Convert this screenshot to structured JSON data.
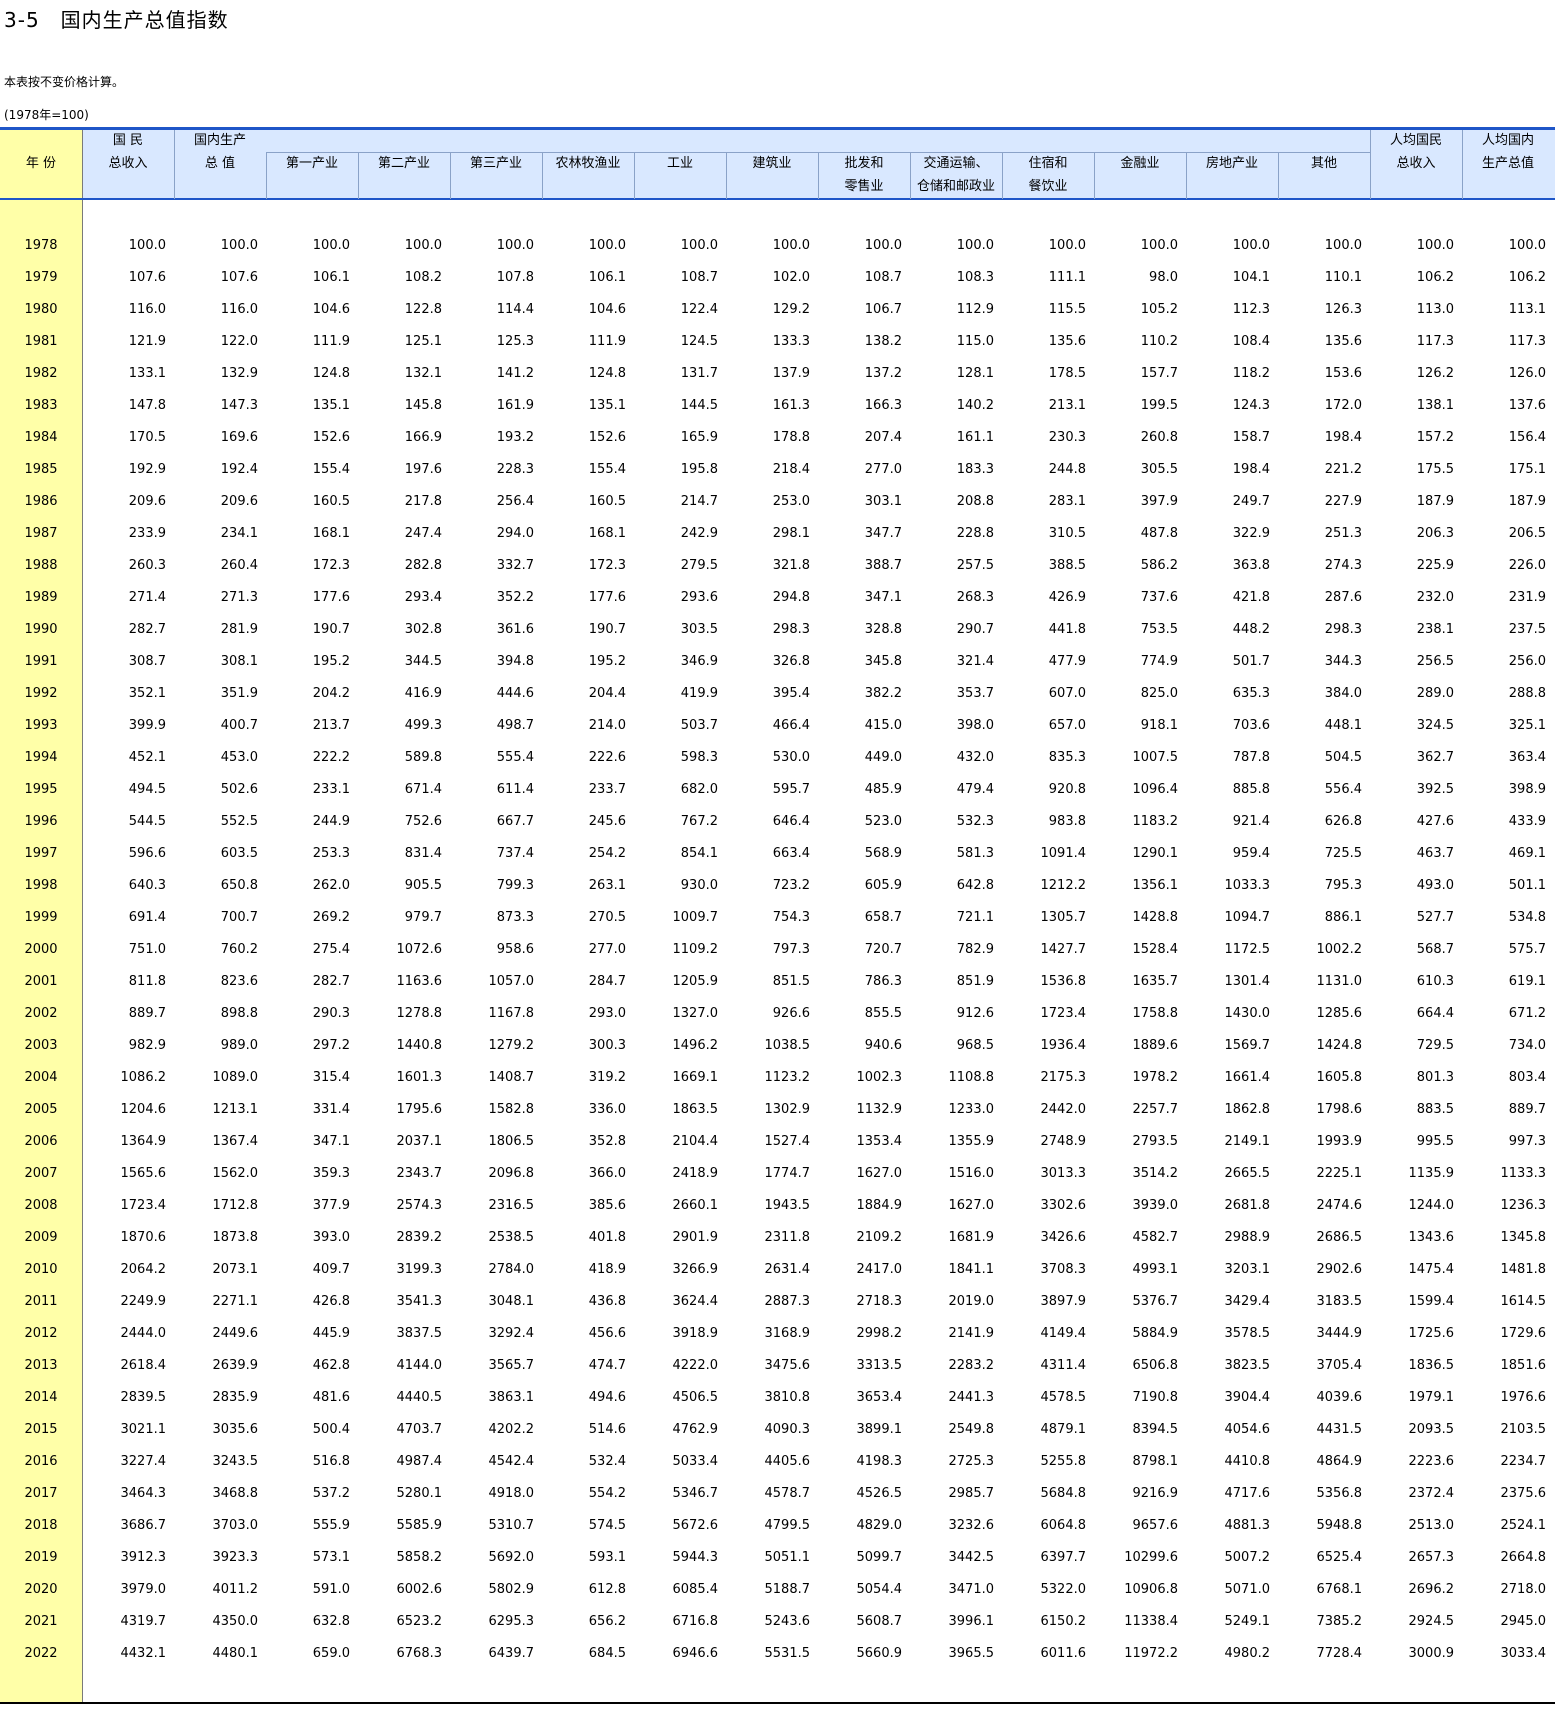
{
  "title": "3-5　国内生产总值指数",
  "note": "本表按不变价格计算。",
  "base": "(1978年=100)",
  "header": {
    "year": "年  份",
    "gni": [
      "国  民",
      "总收入"
    ],
    "gdp": [
      "国内生产",
      "总  值"
    ],
    "primary": "第一产业",
    "secondary": "第二产业",
    "tertiary": "第三产业",
    "agri": "农林牧渔业",
    "industry": "工业",
    "construction": "建筑业",
    "wholesale": [
      "批发和",
      "零售业"
    ],
    "transport": [
      "交通运输、",
      "仓储和邮政业"
    ],
    "hotel": [
      "住宿和",
      "餐饮业"
    ],
    "finance": "金融业",
    "realestate": "房地产业",
    "other": "其他",
    "gni_pc": [
      "人均国民",
      "总收入"
    ],
    "gdp_pc": [
      "人均国内",
      "生产总值"
    ]
  },
  "colors": {
    "header_bg": "#d9e8ff",
    "year_bg": "#ffffa8",
    "rule": "#1f56c8"
  },
  "rows": [
    [
      "1978",
      "100.0",
      "100.0",
      "100.0",
      "100.0",
      "100.0",
      "100.0",
      "100.0",
      "100.0",
      "100.0",
      "100.0",
      "100.0",
      "100.0",
      "100.0",
      "100.0",
      "100.0",
      "100.0"
    ],
    [
      "1979",
      "107.6",
      "107.6",
      "106.1",
      "108.2",
      "107.8",
      "106.1",
      "108.7",
      "102.0",
      "108.7",
      "108.3",
      "111.1",
      "98.0",
      "104.1",
      "110.1",
      "106.2",
      "106.2"
    ],
    [
      "1980",
      "116.0",
      "116.0",
      "104.6",
      "122.8",
      "114.4",
      "104.6",
      "122.4",
      "129.2",
      "106.7",
      "112.9",
      "115.5",
      "105.2",
      "112.3",
      "126.3",
      "113.0",
      "113.1"
    ],
    [
      "1981",
      "121.9",
      "122.0",
      "111.9",
      "125.1",
      "125.3",
      "111.9",
      "124.5",
      "133.3",
      "138.2",
      "115.0",
      "135.6",
      "110.2",
      "108.4",
      "135.6",
      "117.3",
      "117.3"
    ],
    [
      "1982",
      "133.1",
      "132.9",
      "124.8",
      "132.1",
      "141.2",
      "124.8",
      "131.7",
      "137.9",
      "137.2",
      "128.1",
      "178.5",
      "157.7",
      "118.2",
      "153.6",
      "126.2",
      "126.0"
    ],
    [
      "1983",
      "147.8",
      "147.3",
      "135.1",
      "145.8",
      "161.9",
      "135.1",
      "144.5",
      "161.3",
      "166.3",
      "140.2",
      "213.1",
      "199.5",
      "124.3",
      "172.0",
      "138.1",
      "137.6"
    ],
    [
      "1984",
      "170.5",
      "169.6",
      "152.6",
      "166.9",
      "193.2",
      "152.6",
      "165.9",
      "178.8",
      "207.4",
      "161.1",
      "230.3",
      "260.8",
      "158.7",
      "198.4",
      "157.2",
      "156.4"
    ],
    [
      "1985",
      "192.9",
      "192.4",
      "155.4",
      "197.6",
      "228.3",
      "155.4",
      "195.8",
      "218.4",
      "277.0",
      "183.3",
      "244.8",
      "305.5",
      "198.4",
      "221.2",
      "175.5",
      "175.1"
    ],
    [
      "1986",
      "209.6",
      "209.6",
      "160.5",
      "217.8",
      "256.4",
      "160.5",
      "214.7",
      "253.0",
      "303.1",
      "208.8",
      "283.1",
      "397.9",
      "249.7",
      "227.9",
      "187.9",
      "187.9"
    ],
    [
      "1987",
      "233.9",
      "234.1",
      "168.1",
      "247.4",
      "294.0",
      "168.1",
      "242.9",
      "298.1",
      "347.7",
      "228.8",
      "310.5",
      "487.8",
      "322.9",
      "251.3",
      "206.3",
      "206.5"
    ],
    [
      "1988",
      "260.3",
      "260.4",
      "172.3",
      "282.8",
      "332.7",
      "172.3",
      "279.5",
      "321.8",
      "388.7",
      "257.5",
      "388.5",
      "586.2",
      "363.8",
      "274.3",
      "225.9",
      "226.0"
    ],
    [
      "1989",
      "271.4",
      "271.3",
      "177.6",
      "293.4",
      "352.2",
      "177.6",
      "293.6",
      "294.8",
      "347.1",
      "268.3",
      "426.9",
      "737.6",
      "421.8",
      "287.6",
      "232.0",
      "231.9"
    ],
    [
      "1990",
      "282.7",
      "281.9",
      "190.7",
      "302.8",
      "361.6",
      "190.7",
      "303.5",
      "298.3",
      "328.8",
      "290.7",
      "441.8",
      "753.5",
      "448.2",
      "298.3",
      "238.1",
      "237.5"
    ],
    [
      "1991",
      "308.7",
      "308.1",
      "195.2",
      "344.5",
      "394.8",
      "195.2",
      "346.9",
      "326.8",
      "345.8",
      "321.4",
      "477.9",
      "774.9",
      "501.7",
      "344.3",
      "256.5",
      "256.0"
    ],
    [
      "1992",
      "352.1",
      "351.9",
      "204.2",
      "416.9",
      "444.6",
      "204.4",
      "419.9",
      "395.4",
      "382.2",
      "353.7",
      "607.0",
      "825.0",
      "635.3",
      "384.0",
      "289.0",
      "288.8"
    ],
    [
      "1993",
      "399.9",
      "400.7",
      "213.7",
      "499.3",
      "498.7",
      "214.0",
      "503.7",
      "466.4",
      "415.0",
      "398.0",
      "657.0",
      "918.1",
      "703.6",
      "448.1",
      "324.5",
      "325.1"
    ],
    [
      "1994",
      "452.1",
      "453.0",
      "222.2",
      "589.8",
      "555.4",
      "222.6",
      "598.3",
      "530.0",
      "449.0",
      "432.0",
      "835.3",
      "1007.5",
      "787.8",
      "504.5",
      "362.7",
      "363.4"
    ],
    [
      "1995",
      "494.5",
      "502.6",
      "233.1",
      "671.4",
      "611.4",
      "233.7",
      "682.0",
      "595.7",
      "485.9",
      "479.4",
      "920.8",
      "1096.4",
      "885.8",
      "556.4",
      "392.5",
      "398.9"
    ],
    [
      "1996",
      "544.5",
      "552.5",
      "244.9",
      "752.6",
      "667.7",
      "245.6",
      "767.2",
      "646.4",
      "523.0",
      "532.3",
      "983.8",
      "1183.2",
      "921.4",
      "626.8",
      "427.6",
      "433.9"
    ],
    [
      "1997",
      "596.6",
      "603.5",
      "253.3",
      "831.4",
      "737.4",
      "254.2",
      "854.1",
      "663.4",
      "568.9",
      "581.3",
      "1091.4",
      "1290.1",
      "959.4",
      "725.5",
      "463.7",
      "469.1"
    ],
    [
      "1998",
      "640.3",
      "650.8",
      "262.0",
      "905.5",
      "799.3",
      "263.1",
      "930.0",
      "723.2",
      "605.9",
      "642.8",
      "1212.2",
      "1356.1",
      "1033.3",
      "795.3",
      "493.0",
      "501.1"
    ],
    [
      "1999",
      "691.4",
      "700.7",
      "269.2",
      "979.7",
      "873.3",
      "270.5",
      "1009.7",
      "754.3",
      "658.7",
      "721.1",
      "1305.7",
      "1428.8",
      "1094.7",
      "886.1",
      "527.7",
      "534.8"
    ],
    [
      "2000",
      "751.0",
      "760.2",
      "275.4",
      "1072.6",
      "958.6",
      "277.0",
      "1109.2",
      "797.3",
      "720.7",
      "782.9",
      "1427.7",
      "1528.4",
      "1172.5",
      "1002.2",
      "568.7",
      "575.7"
    ],
    [
      "2001",
      "811.8",
      "823.6",
      "282.7",
      "1163.6",
      "1057.0",
      "284.7",
      "1205.9",
      "851.5",
      "786.3",
      "851.9",
      "1536.8",
      "1635.7",
      "1301.4",
      "1131.0",
      "610.3",
      "619.1"
    ],
    [
      "2002",
      "889.7",
      "898.8",
      "290.3",
      "1278.8",
      "1167.8",
      "293.0",
      "1327.0",
      "926.6",
      "855.5",
      "912.6",
      "1723.4",
      "1758.8",
      "1430.0",
      "1285.6",
      "664.4",
      "671.2"
    ],
    [
      "2003",
      "982.9",
      "989.0",
      "297.2",
      "1440.8",
      "1279.2",
      "300.3",
      "1496.2",
      "1038.5",
      "940.6",
      "968.5",
      "1936.4",
      "1889.6",
      "1569.7",
      "1424.8",
      "729.5",
      "734.0"
    ],
    [
      "2004",
      "1086.2",
      "1089.0",
      "315.4",
      "1601.3",
      "1408.7",
      "319.2",
      "1669.1",
      "1123.2",
      "1002.3",
      "1108.8",
      "2175.3",
      "1978.2",
      "1661.4",
      "1605.8",
      "801.3",
      "803.4"
    ],
    [
      "2005",
      "1204.6",
      "1213.1",
      "331.4",
      "1795.6",
      "1582.8",
      "336.0",
      "1863.5",
      "1302.9",
      "1132.9",
      "1233.0",
      "2442.0",
      "2257.7",
      "1862.8",
      "1798.6",
      "883.5",
      "889.7"
    ],
    [
      "2006",
      "1364.9",
      "1367.4",
      "347.1",
      "2037.1",
      "1806.5",
      "352.8",
      "2104.4",
      "1527.4",
      "1353.4",
      "1355.9",
      "2748.9",
      "2793.5",
      "2149.1",
      "1993.9",
      "995.5",
      "997.3"
    ],
    [
      "2007",
      "1565.6",
      "1562.0",
      "359.3",
      "2343.7",
      "2096.8",
      "366.0",
      "2418.9",
      "1774.7",
      "1627.0",
      "1516.0",
      "3013.3",
      "3514.2",
      "2665.5",
      "2225.1",
      "1135.9",
      "1133.3"
    ],
    [
      "2008",
      "1723.4",
      "1712.8",
      "377.9",
      "2574.3",
      "2316.5",
      "385.6",
      "2660.1",
      "1943.5",
      "1884.9",
      "1627.0",
      "3302.6",
      "3939.0",
      "2681.8",
      "2474.6",
      "1244.0",
      "1236.3"
    ],
    [
      "2009",
      "1870.6",
      "1873.8",
      "393.0",
      "2839.2",
      "2538.5",
      "401.8",
      "2901.9",
      "2311.8",
      "2109.2",
      "1681.9",
      "3426.6",
      "4582.7",
      "2988.9",
      "2686.5",
      "1343.6",
      "1345.8"
    ],
    [
      "2010",
      "2064.2",
      "2073.1",
      "409.7",
      "3199.3",
      "2784.0",
      "418.9",
      "3266.9",
      "2631.4",
      "2417.0",
      "1841.1",
      "3708.3",
      "4993.1",
      "3203.1",
      "2902.6",
      "1475.4",
      "1481.8"
    ],
    [
      "2011",
      "2249.9",
      "2271.1",
      "426.8",
      "3541.3",
      "3048.1",
      "436.8",
      "3624.4",
      "2887.3",
      "2718.3",
      "2019.0",
      "3897.9",
      "5376.7",
      "3429.4",
      "3183.5",
      "1599.4",
      "1614.5"
    ],
    [
      "2012",
      "2444.0",
      "2449.6",
      "445.9",
      "3837.5",
      "3292.4",
      "456.6",
      "3918.9",
      "3168.9",
      "2998.2",
      "2141.9",
      "4149.4",
      "5884.9",
      "3578.5",
      "3444.9",
      "1725.6",
      "1729.6"
    ],
    [
      "2013",
      "2618.4",
      "2639.9",
      "462.8",
      "4144.0",
      "3565.7",
      "474.7",
      "4222.0",
      "3475.6",
      "3313.5",
      "2283.2",
      "4311.4",
      "6506.8",
      "3823.5",
      "3705.4",
      "1836.5",
      "1851.6"
    ],
    [
      "2014",
      "2839.5",
      "2835.9",
      "481.6",
      "4440.5",
      "3863.1",
      "494.6",
      "4506.5",
      "3810.8",
      "3653.4",
      "2441.3",
      "4578.5",
      "7190.8",
      "3904.4",
      "4039.6",
      "1979.1",
      "1976.6"
    ],
    [
      "2015",
      "3021.1",
      "3035.6",
      "500.4",
      "4703.7",
      "4202.2",
      "514.6",
      "4762.9",
      "4090.3",
      "3899.1",
      "2549.8",
      "4879.1",
      "8394.5",
      "4054.6",
      "4431.5",
      "2093.5",
      "2103.5"
    ],
    [
      "2016",
      "3227.4",
      "3243.5",
      "516.8",
      "4987.4",
      "4542.4",
      "532.4",
      "5033.4",
      "4405.6",
      "4198.3",
      "2725.3",
      "5255.8",
      "8798.1",
      "4410.8",
      "4864.9",
      "2223.6",
      "2234.7"
    ],
    [
      "2017",
      "3464.3",
      "3468.8",
      "537.2",
      "5280.1",
      "4918.0",
      "554.2",
      "5346.7",
      "4578.7",
      "4526.5",
      "2985.7",
      "5684.8",
      "9216.9",
      "4717.6",
      "5356.8",
      "2372.4",
      "2375.6"
    ],
    [
      "2018",
      "3686.7",
      "3703.0",
      "555.9",
      "5585.9",
      "5310.7",
      "574.5",
      "5672.6",
      "4799.5",
      "4829.0",
      "3232.6",
      "6064.8",
      "9657.6",
      "4881.3",
      "5948.8",
      "2513.0",
      "2524.1"
    ],
    [
      "2019",
      "3912.3",
      "3923.3",
      "573.1",
      "5858.2",
      "5692.0",
      "593.1",
      "5944.3",
      "5051.1",
      "5099.7",
      "3442.5",
      "6397.7",
      "10299.6",
      "5007.2",
      "6525.4",
      "2657.3",
      "2664.8"
    ],
    [
      "2020",
      "3979.0",
      "4011.2",
      "591.0",
      "6002.6",
      "5802.9",
      "612.8",
      "6085.4",
      "5188.7",
      "5054.4",
      "3471.0",
      "5322.0",
      "10906.8",
      "5071.0",
      "6768.1",
      "2696.2",
      "2718.0"
    ],
    [
      "2021",
      "4319.7",
      "4350.0",
      "632.8",
      "6523.2",
      "6295.3",
      "656.2",
      "6716.8",
      "5243.6",
      "5608.7",
      "3996.1",
      "6150.2",
      "11338.4",
      "5249.1",
      "7385.2",
      "2924.5",
      "2945.0"
    ],
    [
      "2022",
      "4432.1",
      "4480.1",
      "659.0",
      "6768.3",
      "6439.7",
      "684.5",
      "6946.6",
      "5531.5",
      "5660.9",
      "3965.5",
      "6011.6",
      "11972.2",
      "4980.2",
      "7728.4",
      "3000.9",
      "3033.4"
    ]
  ]
}
